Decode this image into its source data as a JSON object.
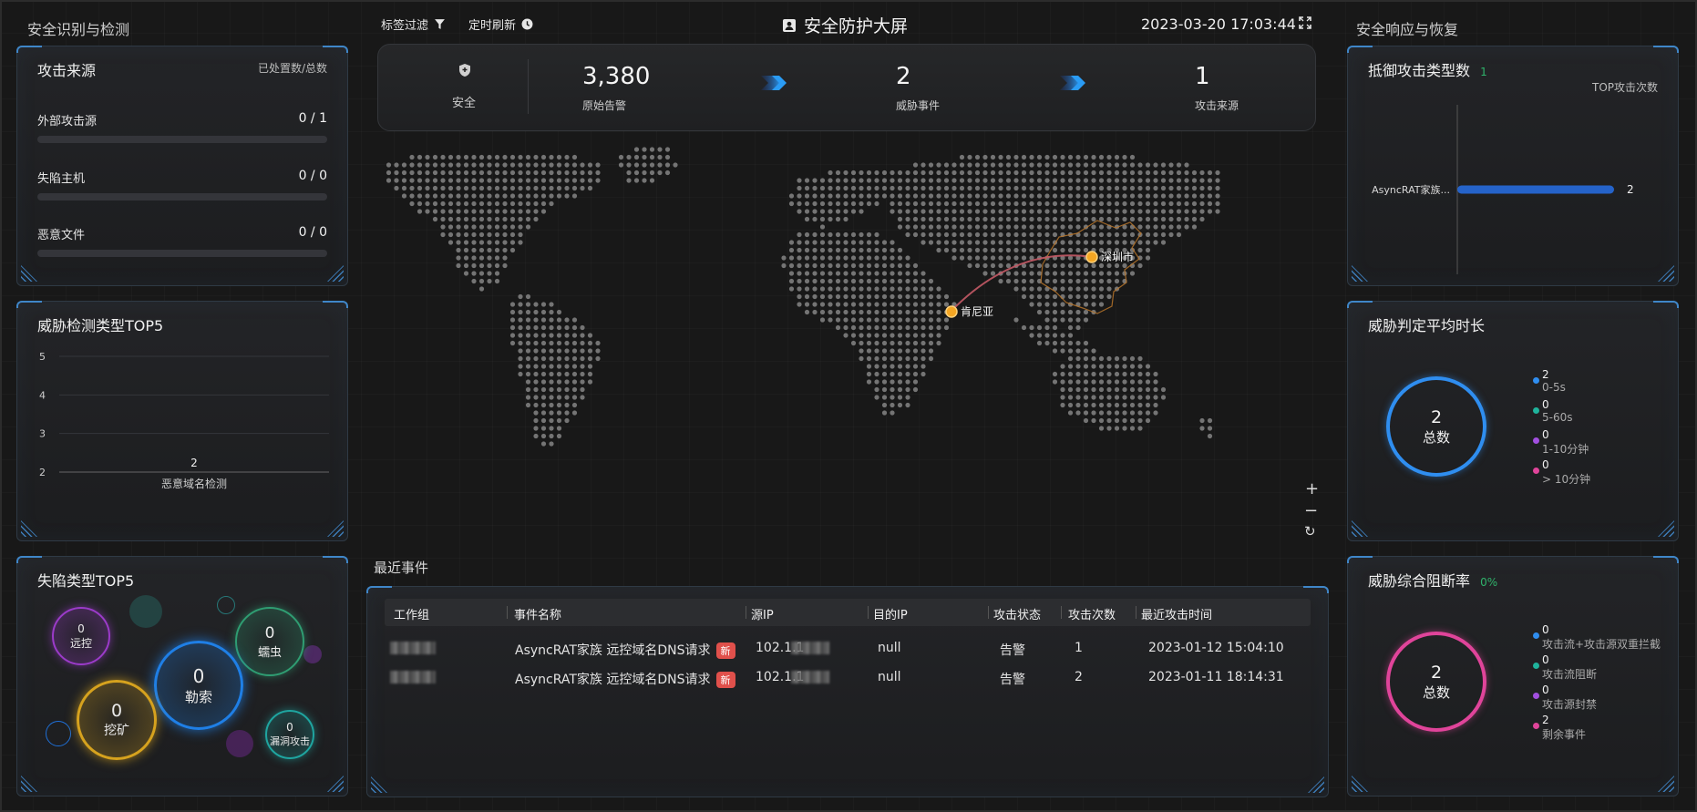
{
  "left_column_title": "安全识别与检测",
  "right_column_title": "安全响应与恢复",
  "topbar": {
    "tag_filter": "标签过滤",
    "timed_refresh": "定时刷新",
    "title": "安全防护大屏",
    "datetime": "2023-03-20 17:03:44"
  },
  "stats": {
    "status_label": "安全",
    "raw_alerts": {
      "value": "3,380",
      "label": "原始告警"
    },
    "threat_events": {
      "value": "2",
      "label": "威胁事件"
    },
    "attack_sources": {
      "value": "1",
      "label": "攻击来源"
    }
  },
  "attack_source_panel": {
    "title": "攻击来源",
    "subtitle": "已处置数/总数",
    "rows": [
      {
        "label": "外部攻击源",
        "value": "0 / 1",
        "fraction": 0
      },
      {
        "label": "失陷主机",
        "value": "0 / 0",
        "fraction": 0
      },
      {
        "label": "恶意文件",
        "value": "0 / 0",
        "fraction": 0
      }
    ]
  },
  "threat_top5_panel": {
    "title": "威胁检测类型TOP5"
  },
  "compromise_top5_panel": {
    "title": "失陷类型TOP5",
    "bubbles": [
      {
        "value": "0",
        "label": "远控",
        "color": "#9b3bc9"
      },
      {
        "value": "0",
        "label": "蠕虫",
        "color": "#2f9d72"
      },
      {
        "value": "0",
        "label": "勒索",
        "color": "#1f7fe6"
      },
      {
        "value": "0",
        "label": "挖矿",
        "color": "#d6a21e"
      },
      {
        "value": "0",
        "label": "漏洞攻击",
        "color": "#1fa5a0"
      }
    ]
  },
  "map": {
    "points": [
      {
        "label": "深圳市"
      },
      {
        "label": "肯尼亚"
      }
    ],
    "zoom_in": "+",
    "zoom_out": "−",
    "reset": "↻"
  },
  "recent_events": {
    "title": "最近事件",
    "columns": [
      "工作组",
      "事件名称",
      "源IP",
      "目的IP",
      "攻击状态",
      "攻击次数",
      "最近攻击时间"
    ],
    "rows": [
      {
        "name": "AsyncRAT家族 远控域名DNS请求",
        "badge": "新",
        "src_ip": "102.1.1",
        "dst_ip": "null",
        "status": "告警",
        "count": "1",
        "last_time": "2023-01-12 15:04:10"
      },
      {
        "name": "AsyncRAT家族 远控域名DNS请求",
        "badge": "新",
        "src_ip": "102.1.1",
        "dst_ip": "null",
        "status": "告警",
        "count": "2",
        "last_time": "2023-01-11 18:14:31"
      }
    ]
  },
  "defense_types_panel": {
    "title": "抵御攻击类型数",
    "count": "1",
    "axis_label": "TOP攻击次数"
  },
  "avg_time_panel": {
    "title": "威胁判定平均时长",
    "total": "2",
    "total_label": "总数",
    "legend": [
      {
        "value": "2",
        "label": "0-5s",
        "color": "#2f8ef0"
      },
      {
        "value": "0",
        "label": "5-60s",
        "color": "#1fb39c"
      },
      {
        "value": "0",
        "label": "1-10分钟",
        "color": "#a24fe0"
      },
      {
        "value": "0",
        "label": "> 10分钟",
        "color": "#e0449a"
      }
    ]
  },
  "block_rate_panel": {
    "title": "威胁综合阻断率",
    "rate": "0%",
    "total": "2",
    "total_label": "总数",
    "legend": [
      {
        "value": "0",
        "label": "攻击流+攻击源双重拦截",
        "color": "#2f8ef0"
      },
      {
        "value": "0",
        "label": "攻击流阻断",
        "color": "#1fb39c"
      },
      {
        "value": "0",
        "label": "攻击源封禁",
        "color": "#a24fe0"
      },
      {
        "value": "2",
        "label": "剩余事件",
        "color": "#e0449a"
      }
    ]
  },
  "chart_data": [
    {
      "type": "bar",
      "categories": [
        "恶意域名检测"
      ],
      "values": [
        2
      ],
      "ylim": [
        2,
        5
      ],
      "yticks": [
        2,
        3,
        4,
        5
      ],
      "grid": true
    },
    {
      "type": "bar",
      "orientation": "horizontal",
      "categories": [
        "AsyncRAT家族..."
      ],
      "values": [
        2
      ],
      "xlabel": "TOP攻击次数",
      "color": "#2563c9"
    }
  ]
}
